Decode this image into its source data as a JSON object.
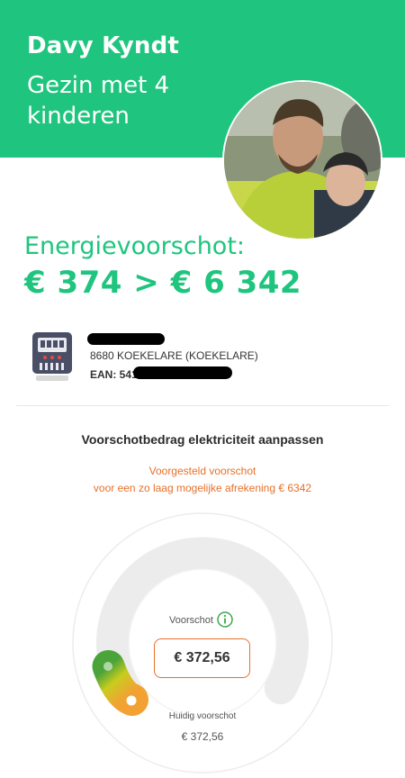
{
  "header": {
    "name": "Davy Kyndt",
    "subtitle": "Gezin met 4 kinderen",
    "bg_color": "#1fc57e"
  },
  "energy": {
    "label": "Energievoorschot:",
    "amount": "€ 374 > € 6 342"
  },
  "meter": {
    "icon": "electricity-meter-icon",
    "address": "8680 KOEKELARE (KOEKELARE)",
    "ean_prefix": "EAN: 5414"
  },
  "adjust": {
    "title": "Voorschotbedrag elektriciteit aanpassen",
    "suggestion_line1": "Voorgesteld voorschot",
    "suggestion_line2": "voor een zo laag mogelijke afrekening € 6342",
    "accent_color": "#e8702a",
    "voorschot_label": "Voorschot",
    "voorschot_value": "€ 372,56",
    "current_label": "Huidig voorschot",
    "current_value": "€ 372,56"
  }
}
